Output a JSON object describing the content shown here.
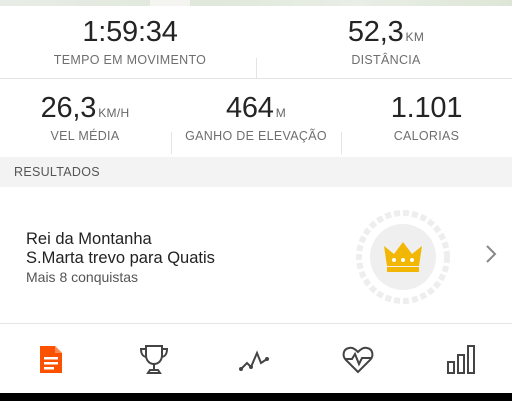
{
  "stats": {
    "moving_time": {
      "value": "1:59:34",
      "unit": "",
      "label": "TEMPO EM MOVIMENTO"
    },
    "distance": {
      "value": "52,3",
      "unit": "KM",
      "label": "DISTÂNCIA"
    },
    "avg_speed": {
      "value": "26,3",
      "unit": "KM/H",
      "label": "VEL MÉDIA"
    },
    "elevation_gain": {
      "value": "464",
      "unit": "M",
      "label": "GANHO DE ELEVAÇÃO"
    },
    "calories": {
      "value": "1.101",
      "unit": "",
      "label": "CALORIAS"
    }
  },
  "results": {
    "section_title": "RESULTADOS",
    "achievement": {
      "title": "Rei da Montanha",
      "segment": "S.Marta trevo para Quatis",
      "more": "Mais 8 conquistas",
      "badge_icon": "crown-icon"
    }
  },
  "tabs": [
    {
      "icon": "document-icon",
      "active": true
    },
    {
      "icon": "trophy-icon",
      "active": false
    },
    {
      "icon": "analysis-icon",
      "active": false
    },
    {
      "icon": "heart-rate-icon",
      "active": false
    },
    {
      "icon": "bar-chart-icon",
      "active": false
    }
  ],
  "colors": {
    "accent": "#fc5200",
    "crown": "#f2b705",
    "icon_dark": "#444444"
  }
}
